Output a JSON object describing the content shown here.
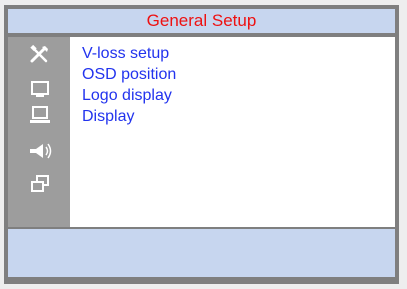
{
  "window": {
    "title": "General Setup"
  },
  "sidebar": {
    "icons": [
      {
        "name": "tools-icon"
      },
      {
        "name": "monitor-icon"
      },
      {
        "name": "laptop-icon"
      },
      {
        "name": "speaker-icon"
      },
      {
        "name": "windows-icon"
      }
    ]
  },
  "menu": {
    "items": [
      {
        "label": "V-loss setup"
      },
      {
        "label": "OSD position"
      },
      {
        "label": "Logo display"
      },
      {
        "label": "Display"
      }
    ]
  },
  "colors": {
    "title_text": "#ee1111",
    "bars": "#c7d6ef",
    "sidebar": "#9d9d9d",
    "menu_text": "#2233ee"
  }
}
